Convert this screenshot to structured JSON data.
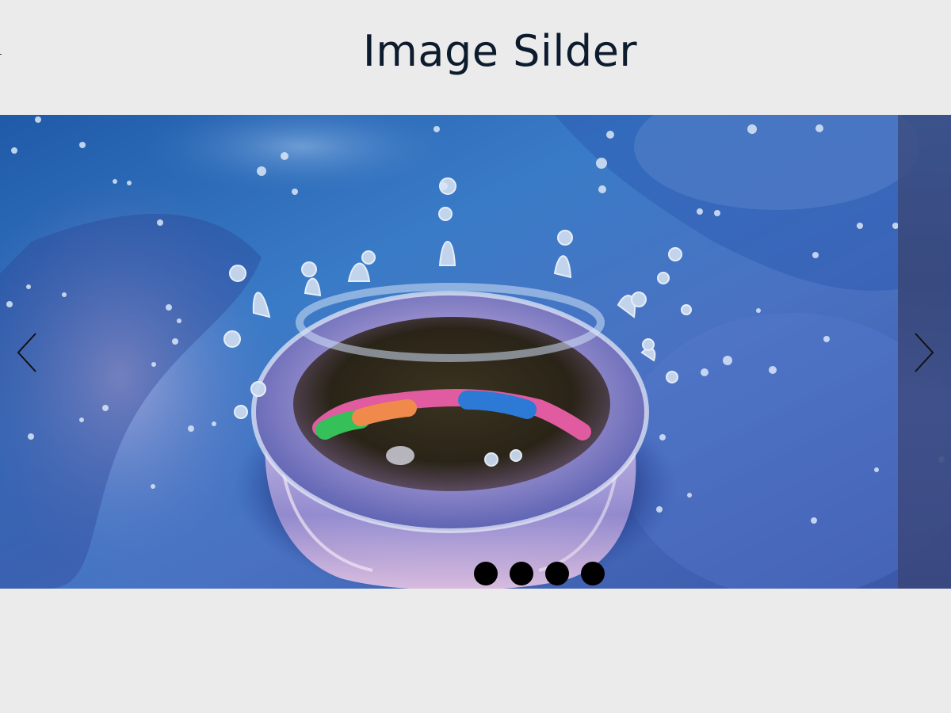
{
  "page": {
    "title": "Image Silder"
  },
  "slider": {
    "current_slide_image": "water-drop-crown-splash",
    "prev_icon": "chevron-left-icon",
    "next_icon": "chevron-right-icon",
    "arrow_color": "#111111",
    "dot_count": 4,
    "dot_color": "#000000",
    "dots": [
      {
        "label": ""
      },
      {
        "label": ""
      },
      {
        "label": ""
      },
      {
        "label": ""
      }
    ]
  }
}
